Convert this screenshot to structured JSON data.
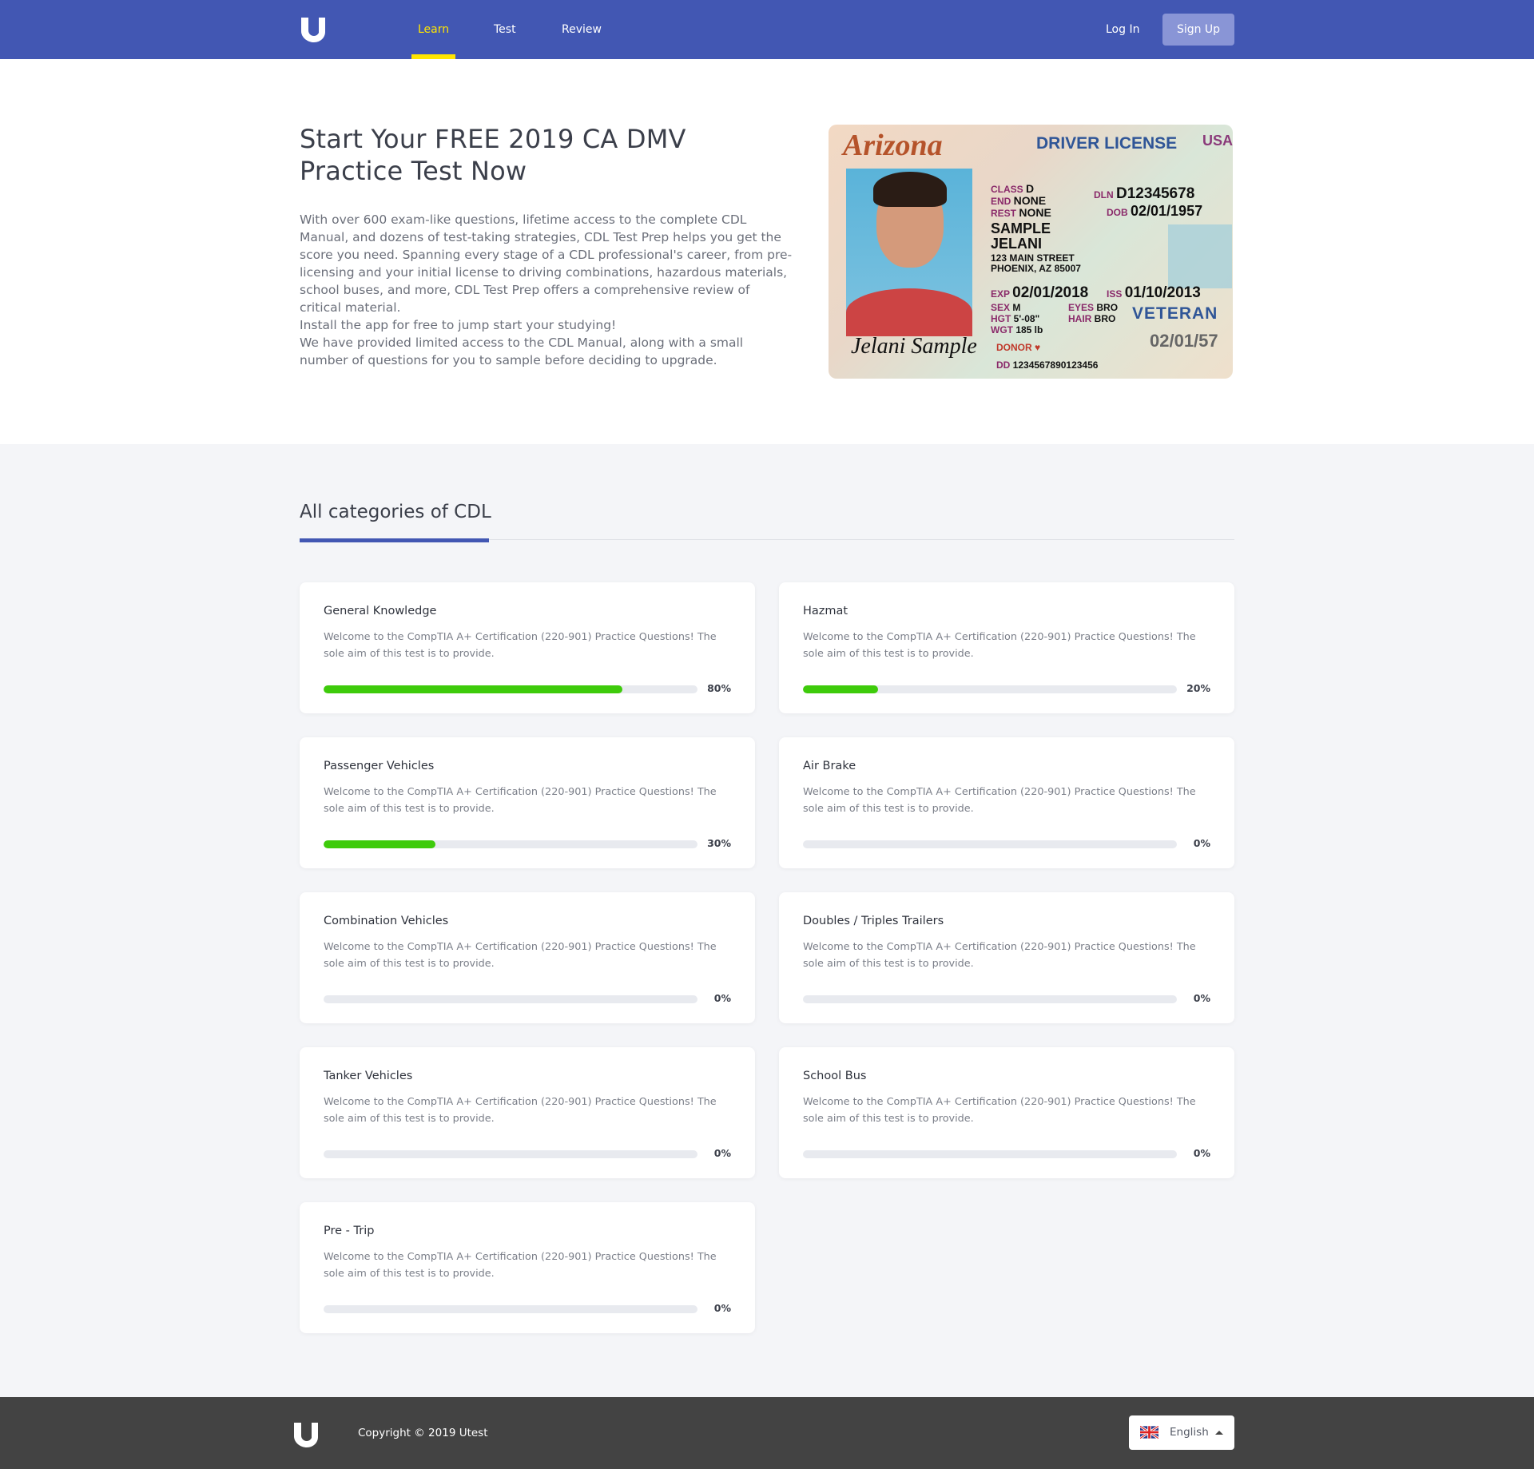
{
  "header": {
    "nav": [
      {
        "label": "Learn",
        "active": true
      },
      {
        "label": "Test"
      },
      {
        "label": "Review"
      }
    ],
    "login": "Log In",
    "signup": "Sign Up"
  },
  "hero": {
    "title": "Start Your FREE 2019 CA DMV Practice Test Now",
    "p1": "With over 600 exam-like questions, lifetime access to the complete CDL Manual, and dozens of test-taking strategies, CDL Test Prep helps you get the score you need. Spanning every stage of a CDL professional's career, from pre-licensing and your initial license to driving combinations, hazardous materials, school buses, and more, CDL Test Prep offers a comprehensive review of critical material.",
    "p2": "Install the app for free to jump start your studying!",
    "p3": "We have provided limited access to the CDL Manual, along with a small number of questions for you to sample before deciding to upgrade.",
    "license": {
      "state": "Arizona",
      "title": "DRIVER LICENSE",
      "country": "USA",
      "class": "D",
      "end": "NONE",
      "rest": "NONE",
      "dln": "D12345678",
      "dob": "02/01/1957",
      "last": "SAMPLE",
      "first": "JELANI",
      "addr1": "123 MAIN STREET",
      "addr2": "PHOENIX, AZ 85007",
      "exp": "02/01/2018",
      "iss": "01/10/2013",
      "sex": "M",
      "hgt": "5'-08\"",
      "wgt": "185 lb",
      "eyes": "BRO",
      "hair": "BRO",
      "veteran": "VETERAN",
      "donor": "DONOR",
      "signature": "Jelani Sample",
      "dd": "1234567890123456",
      "dob_short": "02/01/57"
    }
  },
  "categories": {
    "title": "All categories of CDL",
    "description": "Welcome to the CompTIA A+ Certification (220-901)  Practice Questions! The sole aim of this test is to provide.",
    "items": [
      {
        "name": "General Knowledge",
        "progress": 80,
        "label": "80%"
      },
      {
        "name": "Hazmat",
        "progress": 20,
        "label": "20%"
      },
      {
        "name": "Passenger Vehicles",
        "progress": 30,
        "label": "30%"
      },
      {
        "name": "Air Brake",
        "progress": 0,
        "label": "0%"
      },
      {
        "name": "Combination Vehicles",
        "progress": 0,
        "label": "0%"
      },
      {
        "name": "Doubles / Triples Trailers",
        "progress": 0,
        "label": "0%"
      },
      {
        "name": "Tanker Vehicles",
        "progress": 0,
        "label": "0%"
      },
      {
        "name": "School Bus",
        "progress": 0,
        "label": "0%"
      },
      {
        "name": "Pre - Trip",
        "progress": 0,
        "label": "0%"
      }
    ]
  },
  "footer": {
    "copyright": "Copyright © 2019 Utest",
    "language": "English"
  },
  "colors": {
    "brand": "#4257b3",
    "accent": "#ffe500",
    "progress": "#3ecb0b"
  }
}
